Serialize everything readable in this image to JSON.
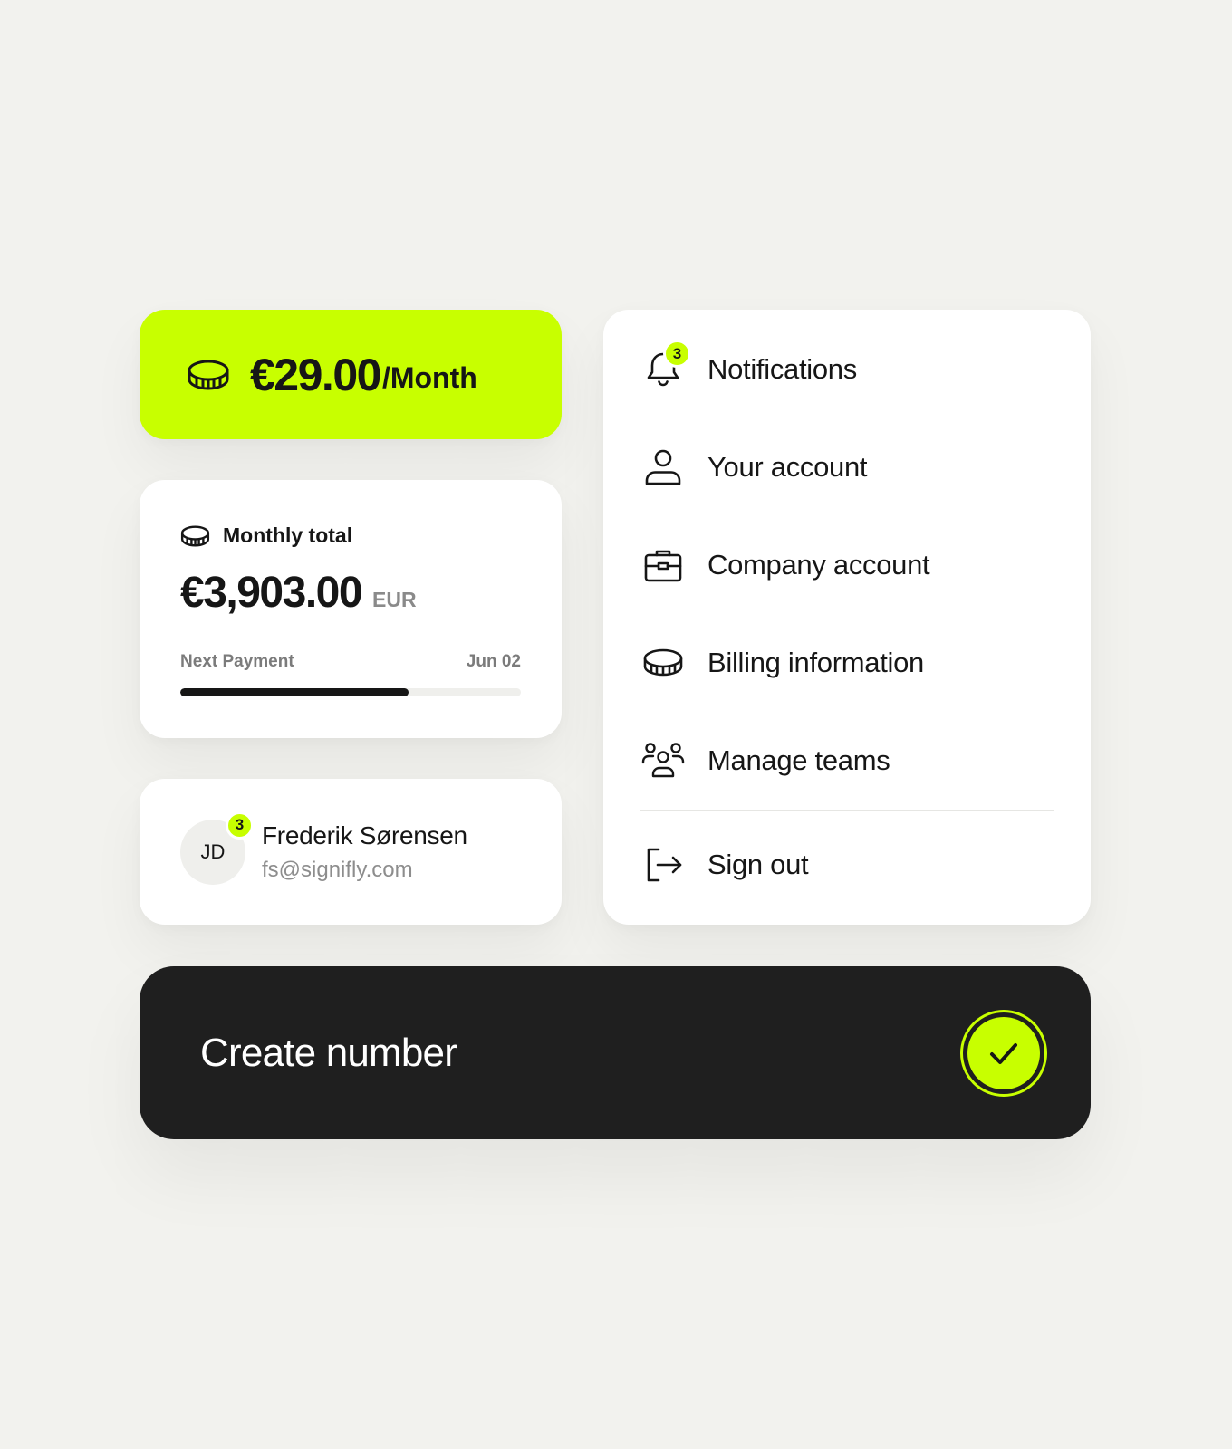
{
  "price": {
    "amount": "€29.00",
    "period": "/Month",
    "icon": "coin-icon"
  },
  "total": {
    "heading": "Monthly total",
    "amount": "€3,903.00",
    "currency": "EUR",
    "next_payment_label": "Next Payment",
    "next_payment_date": "Jun 02",
    "progress_fraction": 0.67
  },
  "profile": {
    "initials": "JD",
    "badge_count": "3",
    "name": "Frederik Sørensen",
    "email": "fs@signifly.com"
  },
  "menu": {
    "notifications_badge": "3",
    "items": [
      {
        "label": "Notifications",
        "icon": "bell-icon"
      },
      {
        "label": "Your account",
        "icon": "user-icon"
      },
      {
        "label": "Company account",
        "icon": "briefcase-icon"
      },
      {
        "label": "Billing information",
        "icon": "coin-icon"
      },
      {
        "label": "Manage teams",
        "icon": "team-icon"
      }
    ],
    "signout": {
      "label": "Sign out",
      "icon": "sign-out-icon"
    }
  },
  "cta": {
    "label": "Create number",
    "icon": "check-icon"
  },
  "colors": {
    "accent": "#c8ff00",
    "dark": "#1f1f1f",
    "background": "#f2f2ee"
  }
}
